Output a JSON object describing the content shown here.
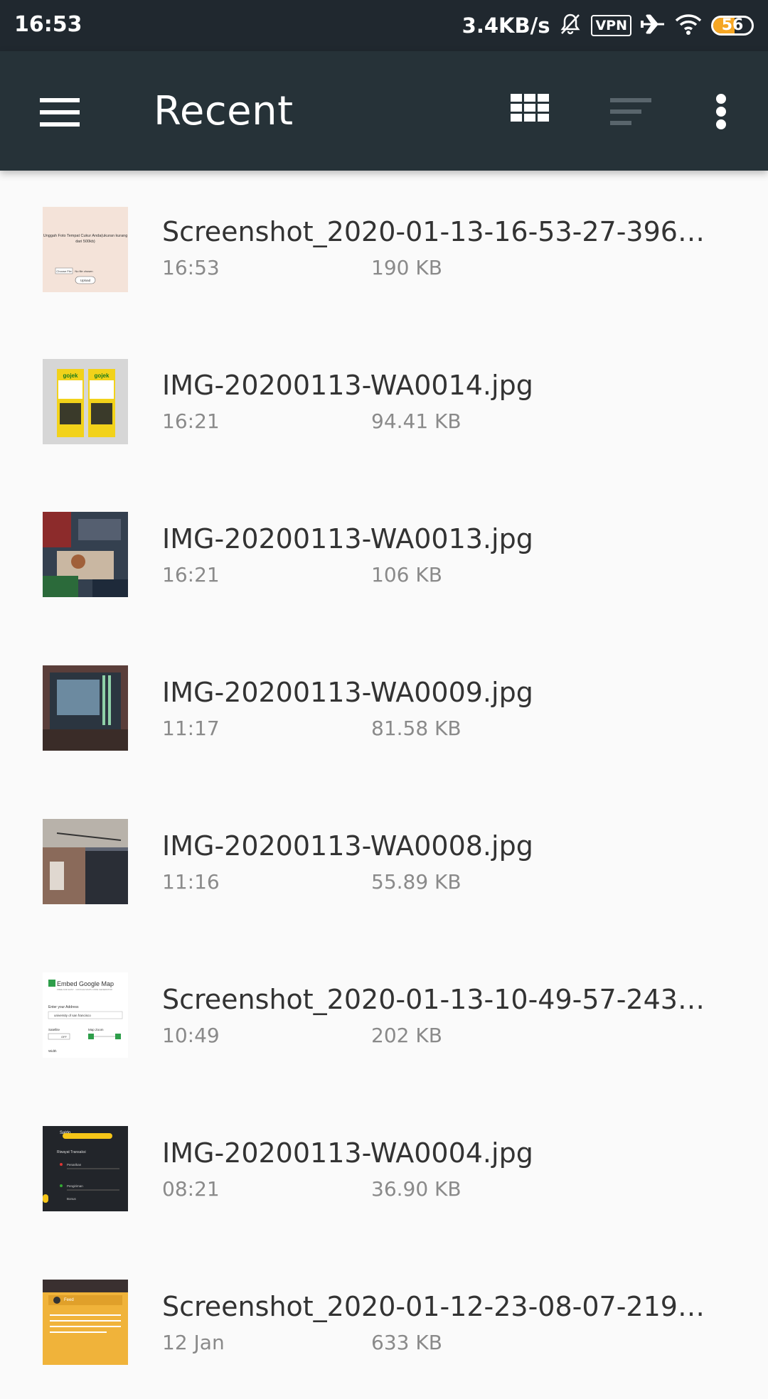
{
  "status_bar": {
    "time": "16:53",
    "net_speed": "3.4KB/s",
    "vpn_label": "VPN",
    "battery_level": "56",
    "battery_fraction": 0.56,
    "icons": [
      "bell-off-icon",
      "vpn-icon",
      "airplane-icon",
      "wifi-icon",
      "battery-icon"
    ]
  },
  "app_bar": {
    "title": "Recent",
    "icons": [
      "menu-icon",
      "grid-view-icon",
      "sort-icon",
      "more-options-icon"
    ]
  },
  "files": [
    {
      "name": "Screenshot_2020-01-13-16-53-27-396_co...",
      "time": "16:53",
      "size": "190 KB"
    },
    {
      "name": "IMG-20200113-WA0014.jpg",
      "time": "16:21",
      "size": "94.41 KB"
    },
    {
      "name": "IMG-20200113-WA0013.jpg",
      "time": "16:21",
      "size": "106 KB"
    },
    {
      "name": "IMG-20200113-WA0009.jpg",
      "time": "11:17",
      "size": "81.58 KB"
    },
    {
      "name": "IMG-20200113-WA0008.jpg",
      "time": "11:16",
      "size": "55.89 KB"
    },
    {
      "name": "Screenshot_2020-01-13-10-49-57-243_co...",
      "time": "10:49",
      "size": "202 KB"
    },
    {
      "name": "IMG-20200113-WA0004.jpg",
      "time": "08:21",
      "size": "36.90 KB"
    },
    {
      "name": "Screenshot_2020-01-12-23-08-07-219_co...",
      "time": "12 Jan",
      "size": "633 KB"
    }
  ],
  "thumbnails": {
    "upload_form": {
      "line1": "Unggah Foto Tempat Cukur Anda(ukuran kurang",
      "line2": "dari 500kb)",
      "choose": "Choose File",
      "nofile": "No file chosen",
      "upload": "Upload"
    },
    "gojek_banner": {
      "brand": "gojek"
    },
    "google_map": {
      "title": "Embed Google Map",
      "subtitle": "FREE AND EASY · GOOGLE MAPS CODE GENERATOR",
      "address_label": "Enter your Address",
      "address_value": "university of san francisco",
      "satellite_label": "Satellite",
      "off_label": "OFF",
      "zoom_label": "Map Zoom",
      "width_label": "Width"
    },
    "saldo": {
      "title": "Saldo",
      "history": "Riwayat Transaksi",
      "item1": "Penarikan",
      "item2": "Pengiriman",
      "item3": "Bonus"
    },
    "feed": {
      "title": "Feed"
    }
  },
  "colors": {
    "status_bar_bg": "#20282f",
    "app_bar_bg": "#263238",
    "list_bg": "#fafafa",
    "battery_accent": "#f5a623"
  }
}
